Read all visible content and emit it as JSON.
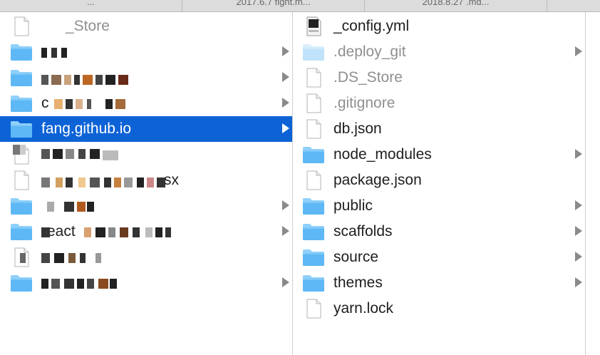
{
  "tabs": [
    {
      "label": "...",
      "w": 255
    },
    {
      "label": "2017.6.7 fight.m...",
      "w": 255
    },
    {
      "label": "2018.8.27 .md...",
      "w": 255
    }
  ],
  "column1": {
    "items": [
      {
        "label": "_Store",
        "icon": "file-icon",
        "arrow": false,
        "dim": true
      },
      {
        "label": "",
        "icon": "folder-icon",
        "arrow": true
      },
      {
        "label": "",
        "icon": "folder-icon",
        "arrow": true
      },
      {
        "label": "c",
        "icon": "folder-icon",
        "arrow": true
      },
      {
        "label": "fang.github.io",
        "icon": "folder-icon",
        "arrow": true,
        "selected": true
      },
      {
        "label": "",
        "icon": "file-icon",
        "arrow": false
      },
      {
        "label": "sx",
        "icon": "file-icon",
        "arrow": false
      },
      {
        "label": "",
        "icon": "folder-icon",
        "arrow": true
      },
      {
        "label": "eact",
        "icon": "folder-icon",
        "arrow": true
      },
      {
        "label": "",
        "icon": "file-icon",
        "arrow": false
      },
      {
        "label": "",
        "icon": "folder-icon",
        "arrow": true
      }
    ]
  },
  "column2": {
    "items": [
      {
        "label": "_config.yml",
        "icon": "yaml-file-icon",
        "arrow": false
      },
      {
        "label": ".deploy_git",
        "icon": "folder-icon",
        "arrow": true,
        "dim": true
      },
      {
        "label": ".DS_Store",
        "icon": "file-icon",
        "arrow": false,
        "dim": true
      },
      {
        "label": ".gitignore",
        "icon": "file-icon",
        "arrow": false,
        "dim": true
      },
      {
        "label": "db.json",
        "icon": "file-icon",
        "arrow": false
      },
      {
        "label": "node_modules",
        "icon": "folder-icon",
        "arrow": true
      },
      {
        "label": "package.json",
        "icon": "file-icon",
        "arrow": false
      },
      {
        "label": "public",
        "icon": "folder-icon",
        "arrow": true
      },
      {
        "label": "scaffolds",
        "icon": "folder-icon",
        "arrow": true
      },
      {
        "label": "source",
        "icon": "folder-icon",
        "arrow": true
      },
      {
        "label": "themes",
        "icon": "folder-icon",
        "arrow": true
      },
      {
        "label": "yarn.lock",
        "icon": "file-icon",
        "arrow": false
      }
    ]
  },
  "colors": {
    "selection": "#0d63d6",
    "folder": "#5eb8f5",
    "folder_dim": "#bfe3fb"
  }
}
